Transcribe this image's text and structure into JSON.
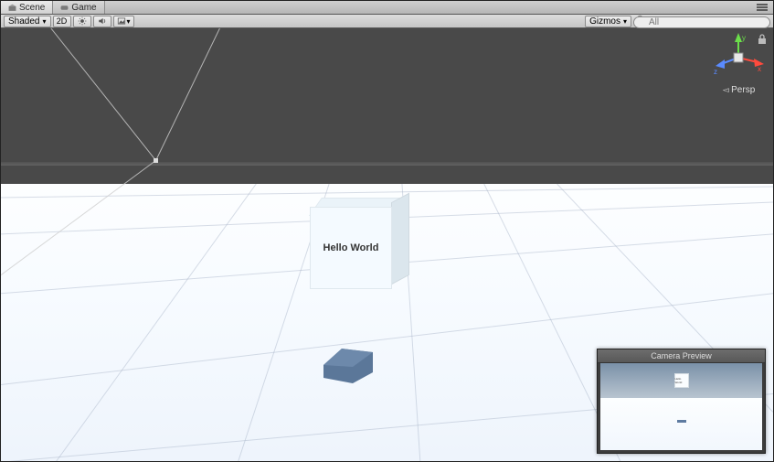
{
  "tabs": {
    "scene": "Scene",
    "game": "Game"
  },
  "toolbar": {
    "shading_mode": "Shaded",
    "mode_2d": "2D",
    "gizmos_label": "Gizmos",
    "search_placeholder": "All"
  },
  "scene": {
    "text_on_cube": "Hello World",
    "persp_label": "Persp",
    "axes": {
      "x": "x",
      "y": "y",
      "z": "z"
    }
  },
  "camera_preview": {
    "title": "Camera Preview"
  }
}
